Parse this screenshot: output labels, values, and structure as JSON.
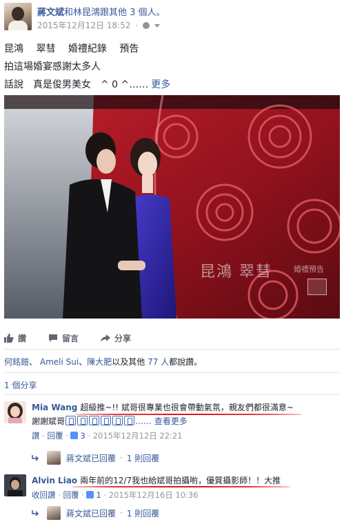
{
  "post": {
    "author": "蔣文斌",
    "with_text": "和林昆鴻跟其他 3 個人。",
    "timestamp": "2015年12月12日 18:52",
    "meta_separator": "·",
    "privacy_icon": "globe-icon",
    "text_line1": [
      "昆鴻",
      "翠彗",
      "婚禮紀錄",
      "預告"
    ],
    "text_line2": "拍這場婚宴感謝太多人",
    "text_line3": "話說　真是俊男美女　^ 0 ^……",
    "more_label": "更多",
    "photo": {
      "watermark_names": "昆鴻  翠彗",
      "watermark_sub": "婚禮預告"
    }
  },
  "actions": {
    "like": "讚",
    "comment": "留言",
    "share": "分享"
  },
  "likes": {
    "names": [
      "何銘鎧",
      "Ameli Sui",
      "陳大肥"
    ],
    "sep1": "、",
    "sep2": "、",
    "others_prefix": "以及其他",
    "others_count": "77 人",
    "suffix": "都說讚。"
  },
  "shares": "1 個分享",
  "comments": [
    {
      "name": "Mia Wang",
      "text": "超級推~!! 斌哥很專業也很會帶動氣氛，親友們都很滿意~",
      "text_line2_prefix": "謝謝斌哥",
      "see_more": "…… 查看更多",
      "like_label": "讚",
      "reply_label": "回覆",
      "like_count": "3",
      "timestamp": "2015年12月12日 22:21",
      "reply_author": "蔣文斌已回覆",
      "reply_count": "1 則回覆"
    },
    {
      "name": "Alvin Liao",
      "text": "兩年前的12/7我也給斌哥拍攝喲，優質攝影師！！大推",
      "unlike_label": "收回讚",
      "reply_label": "回覆",
      "like_count": "1",
      "timestamp": "2015年12月16日 10:36",
      "reply_author": "蔣文斌已回覆",
      "reply_count": "1 則回覆"
    }
  ],
  "colors": {
    "link": "#365899",
    "meta": "#90949c",
    "annotation_red": "#e3141b"
  }
}
